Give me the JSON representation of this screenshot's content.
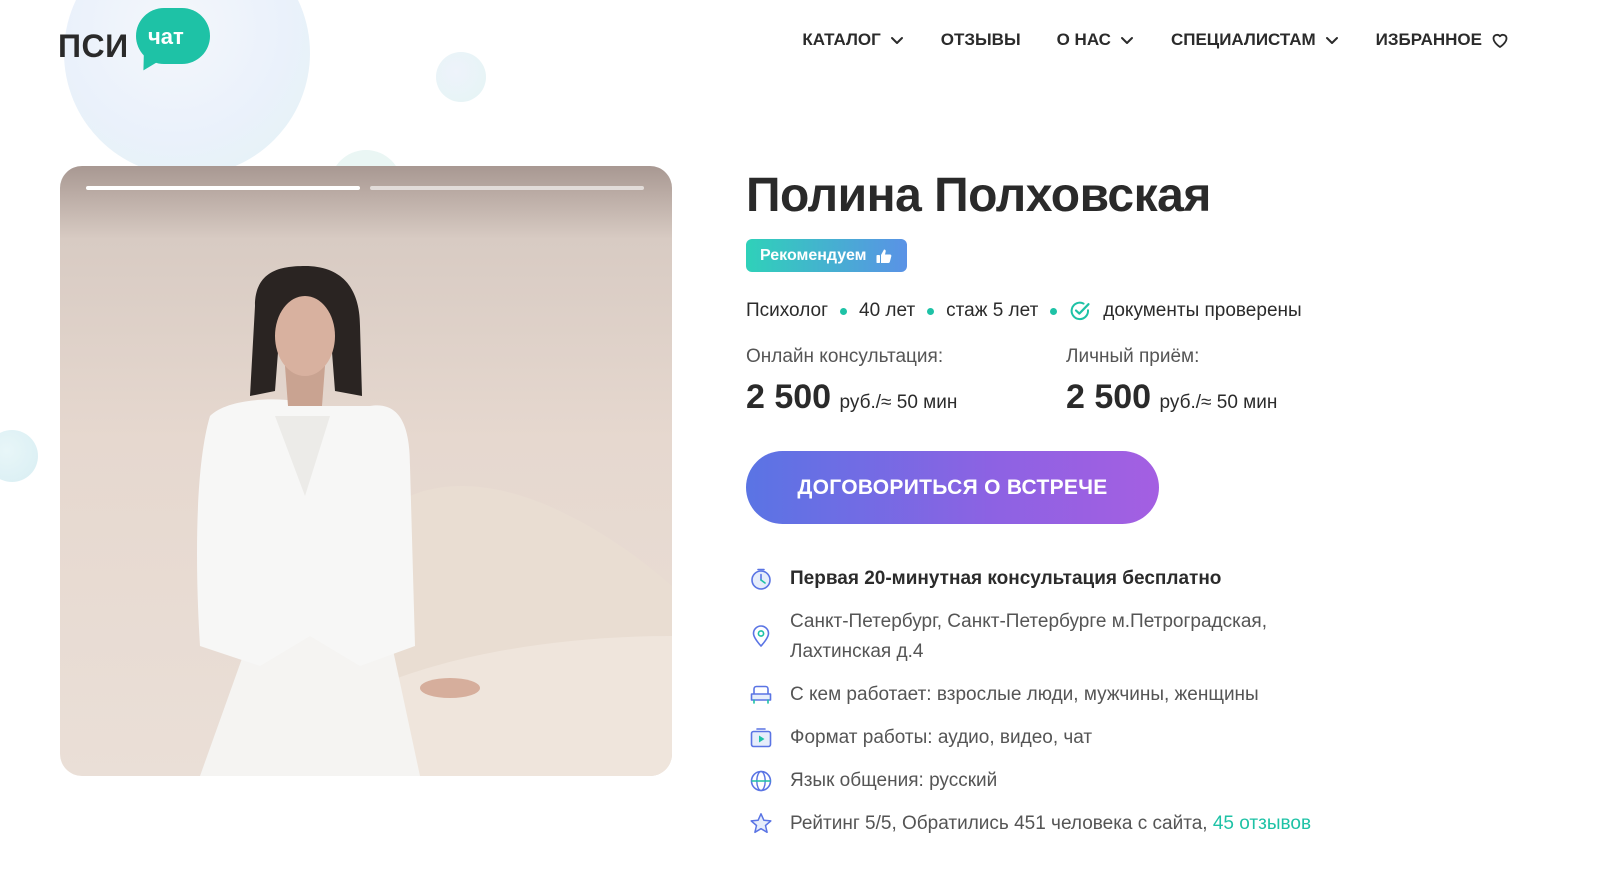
{
  "brand": {
    "logo_main": "ПСИ",
    "logo_bubble": "чат",
    "accent_color": "#1ec2a6"
  },
  "nav": {
    "items": [
      {
        "label": "КАТАЛОГ",
        "icon": "chevron-down-icon"
      },
      {
        "label": "ОТЗЫВЫ"
      },
      {
        "label": "О НАС",
        "icon": "chevron-down-icon"
      },
      {
        "label": "СПЕЦИАЛИСТАМ",
        "icon": "chevron-down-icon"
      },
      {
        "label": "ИЗБРАННОЕ",
        "icon": "heart-icon"
      }
    ]
  },
  "gallery": {
    "slides_total": 2,
    "active_slide": 1
  },
  "profile": {
    "name": "Полина Полховская",
    "badge": "Рекомендуем",
    "badge_icon": "thumbs-up-icon",
    "profession": "Психолог",
    "age": "40 лет",
    "experience": "стаж 5 лет",
    "verified": "документы проверены",
    "verified_icon": "check-circle-icon"
  },
  "prices": {
    "online": {
      "label": "Онлайн консультация:",
      "value": "2 500",
      "unit": "руб./≈ 50 мин"
    },
    "in_person": {
      "label": "Личный приём:",
      "value": "2 500",
      "unit": "руб./≈ 50 мин"
    }
  },
  "cta": {
    "label": "ДОГОВОРИТЬСЯ О ВСТРЕЧЕ"
  },
  "features": {
    "free": {
      "icon": "timer-icon",
      "text": "Первая 20-минутная консультация бесплатно"
    },
    "address": {
      "icon": "location-pin-icon",
      "line1": "Санкт-Петербург, Санкт-Петербурге м.Петроградская,",
      "line2": "Лахтинская д.4"
    },
    "clients": {
      "icon": "armchair-icon",
      "text": "С кем работает: взрослые люди, мужчины, женщины"
    },
    "format": {
      "icon": "video-play-icon",
      "text": "Формат работы: аудио, видео, чат"
    },
    "language": {
      "icon": "globe-icon",
      "text": "Язык общения: русский"
    },
    "rating": {
      "icon": "star-icon",
      "text": "Рейтинг 5/5, Обратились 451 человека с сайта, ",
      "link": "45 отзывов"
    }
  }
}
